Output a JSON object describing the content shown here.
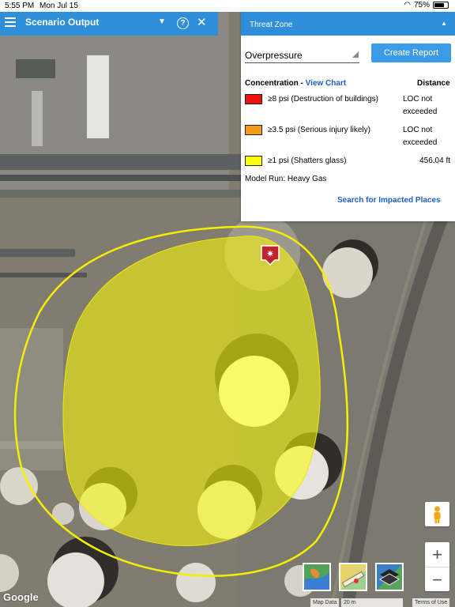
{
  "status_bar": {
    "time": "5:55 PM",
    "date": "Mon Jul 15",
    "battery": "75%",
    "battery_level": 0.75
  },
  "app_bar": {
    "title": "Scenario Output"
  },
  "panel": {
    "header": "Threat Zone",
    "select_value": "Overpressure",
    "create_report_label": "Create Report",
    "concentration_label": "Concentration",
    "view_chart_label": "View Chart",
    "distance_label": "Distance",
    "rows": [
      {
        "color": "#ee1111",
        "label": "≥8 psi (Destruction of buildings)",
        "distance": "LOC not exceeded"
      },
      {
        "color": "#f59a1a",
        "label": "≥3.5 psi (Serious injury likely)",
        "distance": "LOC not exceeded"
      },
      {
        "color": "#ffff00",
        "label": "≥1 psi (Shatters glass)",
        "distance": "456.04 ft"
      }
    ],
    "model_run": "Model Run: Heavy Gas",
    "search_label": "Search for Impacted Places"
  },
  "map": {
    "zoom_in": "+",
    "zoom_out": "−",
    "google_logo": "Google",
    "attribution": {
      "map_data": "Map Data",
      "scale": "20 m",
      "terms": "Terms of Use"
    },
    "threat_zone_color": "#ffff00",
    "layer_buttons": [
      "map-style-icon",
      "measure-icon",
      "layers-icon"
    ]
  }
}
